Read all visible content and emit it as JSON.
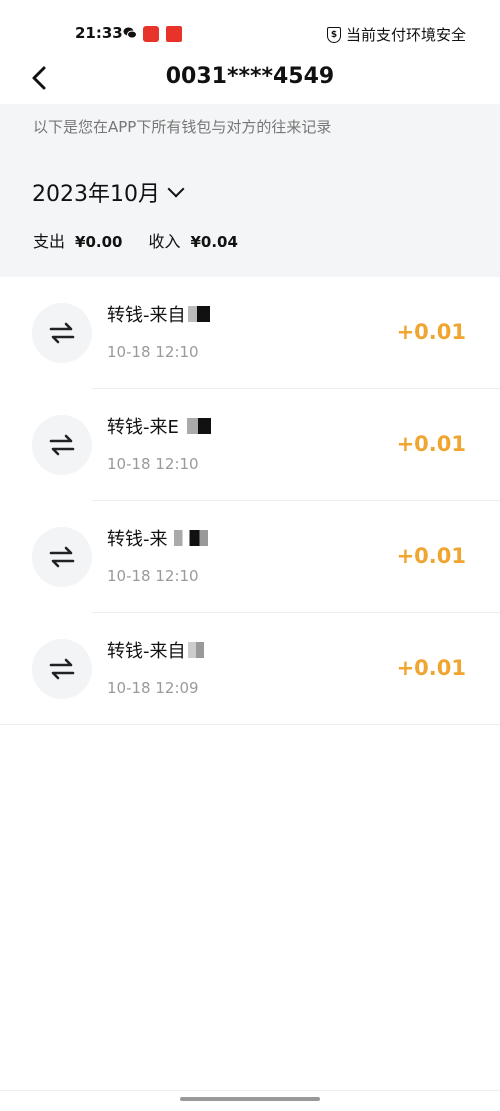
{
  "status_bar": {
    "time": "21:33",
    "secure_text": "当前支付环境安全"
  },
  "header": {
    "title": "0031****4549"
  },
  "panel": {
    "hint": "以下是您在APP下所有钱包与对方的往来记录",
    "month": "2023年10月",
    "expense_label": "支出",
    "expense_value": "¥0.00",
    "income_label": "收入",
    "income_value": "¥0.04"
  },
  "transactions": [
    {
      "title": "转钱-来自",
      "time": "10-18 12:10",
      "amount": "+0.01"
    },
    {
      "title": "转钱-来E",
      "time": "10-18 12:10",
      "amount": "+0.01"
    },
    {
      "title": "转钱-来",
      "time": "10-18 12:10",
      "amount": "+0.01"
    },
    {
      "title": "转钱-来自",
      "time": "10-18 12:09",
      "amount": "+0.01"
    }
  ],
  "colors": {
    "amount": "#f0a531",
    "panel_bg": "#f4f5f7"
  },
  "icons": {
    "back": "chevron-left-icon",
    "month_toggle": "chevron-down-icon",
    "transfer": "transfer-arrows-icon",
    "secure": "shield-icon"
  }
}
